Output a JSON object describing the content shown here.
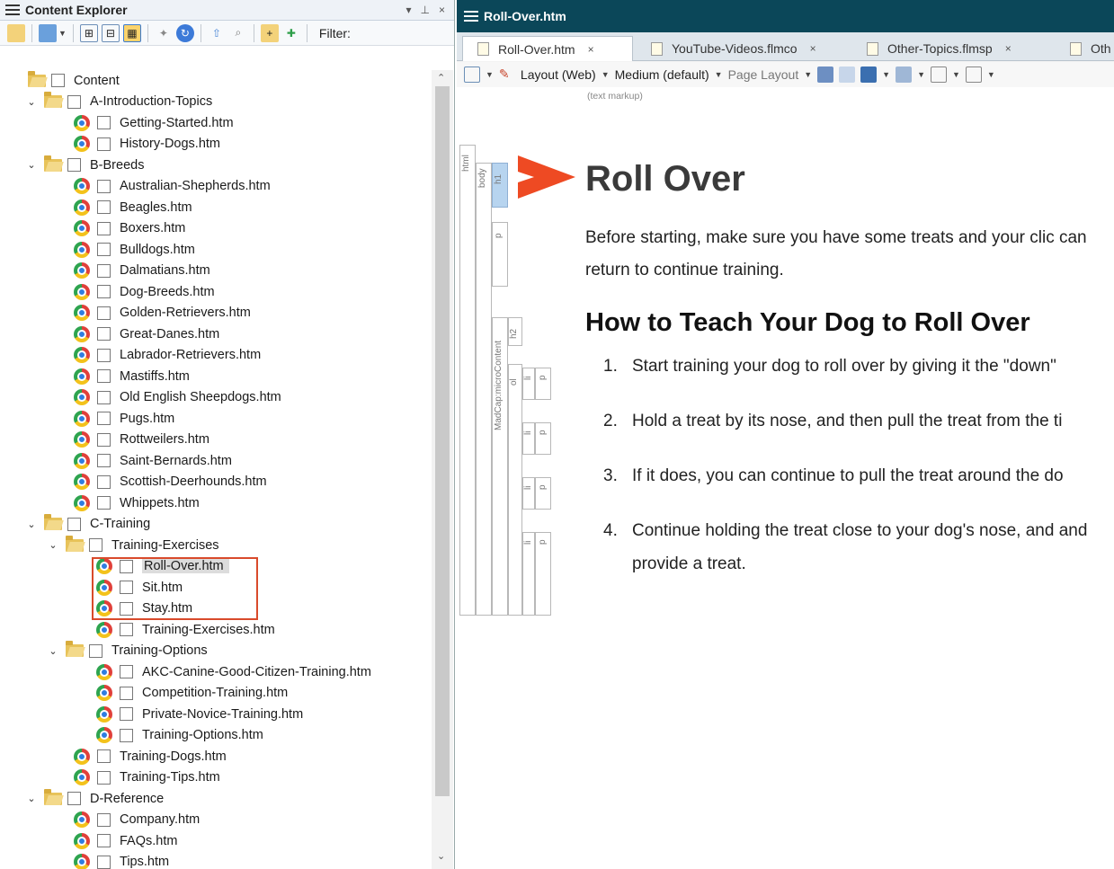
{
  "left_pane": {
    "title": "Content Explorer",
    "pin_glyph": "▾  ᵖ  ×",
    "filter_label": "Filter:",
    "tree": [
      {
        "label": "Content",
        "indent": 0,
        "type": "folder",
        "chev": ""
      },
      {
        "label": "A-Introduction-Topics",
        "indent": 1,
        "type": "folder",
        "chev": "⌄"
      },
      {
        "label": "Getting-Started.htm",
        "indent": 2,
        "type": "file"
      },
      {
        "label": "History-Dogs.htm",
        "indent": 2,
        "type": "file"
      },
      {
        "label": "B-Breeds",
        "indent": 1,
        "type": "folder",
        "chev": "⌄"
      },
      {
        "label": "Australian-Shepherds.htm",
        "indent": 2,
        "type": "file"
      },
      {
        "label": "Beagles.htm",
        "indent": 2,
        "type": "file"
      },
      {
        "label": "Boxers.htm",
        "indent": 2,
        "type": "file"
      },
      {
        "label": "Bulldogs.htm",
        "indent": 2,
        "type": "file"
      },
      {
        "label": "Dalmatians.htm",
        "indent": 2,
        "type": "file"
      },
      {
        "label": "Dog-Breeds.htm",
        "indent": 2,
        "type": "file"
      },
      {
        "label": "Golden-Retrievers.htm",
        "indent": 2,
        "type": "file"
      },
      {
        "label": "Great-Danes.htm",
        "indent": 2,
        "type": "file"
      },
      {
        "label": "Labrador-Retrievers.htm",
        "indent": 2,
        "type": "file"
      },
      {
        "label": "Mastiffs.htm",
        "indent": 2,
        "type": "file"
      },
      {
        "label": "Old English Sheepdogs.htm",
        "indent": 2,
        "type": "file"
      },
      {
        "label": "Pugs.htm",
        "indent": 2,
        "type": "file"
      },
      {
        "label": "Rottweilers.htm",
        "indent": 2,
        "type": "file"
      },
      {
        "label": "Saint-Bernards.htm",
        "indent": 2,
        "type": "file"
      },
      {
        "label": "Scottish-Deerhounds.htm",
        "indent": 2,
        "type": "file"
      },
      {
        "label": "Whippets.htm",
        "indent": 2,
        "type": "file"
      },
      {
        "label": "C-Training",
        "indent": 1,
        "type": "folder",
        "chev": "⌄"
      },
      {
        "label": "Training-Exercises",
        "indent": 2,
        "type": "folder",
        "chev": "⌄"
      },
      {
        "label": "Roll-Over.htm",
        "indent": 3,
        "type": "file",
        "selected": true
      },
      {
        "label": "Sit.htm",
        "indent": 3,
        "type": "file"
      },
      {
        "label": "Stay.htm",
        "indent": 3,
        "type": "file"
      },
      {
        "label": "Training-Exercises.htm",
        "indent": 3,
        "type": "file"
      },
      {
        "label": "Training-Options",
        "indent": 2,
        "type": "folder",
        "chev": "⌄"
      },
      {
        "label": "AKC-Canine-Good-Citizen-Training.htm",
        "indent": 3,
        "type": "file"
      },
      {
        "label": "Competition-Training.htm",
        "indent": 3,
        "type": "file"
      },
      {
        "label": "Private-Novice-Training.htm",
        "indent": 3,
        "type": "file"
      },
      {
        "label": "Training-Options.htm",
        "indent": 3,
        "type": "file"
      },
      {
        "label": "Training-Dogs.htm",
        "indent": 2,
        "type": "file"
      },
      {
        "label": "Training-Tips.htm",
        "indent": 2,
        "type": "file"
      },
      {
        "label": "D-Reference",
        "indent": 1,
        "type": "folder",
        "chev": "⌄"
      },
      {
        "label": "Company.htm",
        "indent": 2,
        "type": "file"
      },
      {
        "label": "FAQs.htm",
        "indent": 2,
        "type": "file"
      },
      {
        "label": "Tips.htm",
        "indent": 2,
        "type": "file"
      }
    ]
  },
  "right_pane": {
    "title": "Roll-Over.htm",
    "tabs": [
      "Roll-Over.htm",
      "YouTube-Videos.flmco",
      "Other-Topics.flmsp",
      "Oth"
    ],
    "tab_close": "×",
    "toolbar": {
      "layout": "Layout (Web)",
      "medium": "Medium (default)",
      "page_layout": "Page Layout"
    },
    "markup_note": "(text markup)",
    "structure_labels": {
      "html": "html",
      "body": "body",
      "h1": "h1",
      "p": "p",
      "h2": "h2",
      "microcontent": "MadCap:microContent",
      "ol": "ol",
      "li": "li"
    },
    "document": {
      "h1": "Roll Over",
      "intro": "Before starting, make sure you have some treats and your clic can return to continue training.",
      "h2": "How to Teach Your Dog to Roll Over",
      "steps": [
        {
          "num": "1.",
          "text": "Start training your dog to roll over by giving it the \"down\" "
        },
        {
          "num": "2.",
          "text": "Hold a treat by its nose, and then pull the treat from the ti"
        },
        {
          "num": "3.",
          "text": "If it does, you can continue to pull the treat around the do"
        },
        {
          "num": "4.",
          "text": "Continue holding the treat close to your dog's nose, and and provide a treat."
        }
      ]
    }
  },
  "colors": {
    "doc_header": "#0b4759",
    "highlight_box": "#d94a2b",
    "arrow": "#ee4a23"
  }
}
